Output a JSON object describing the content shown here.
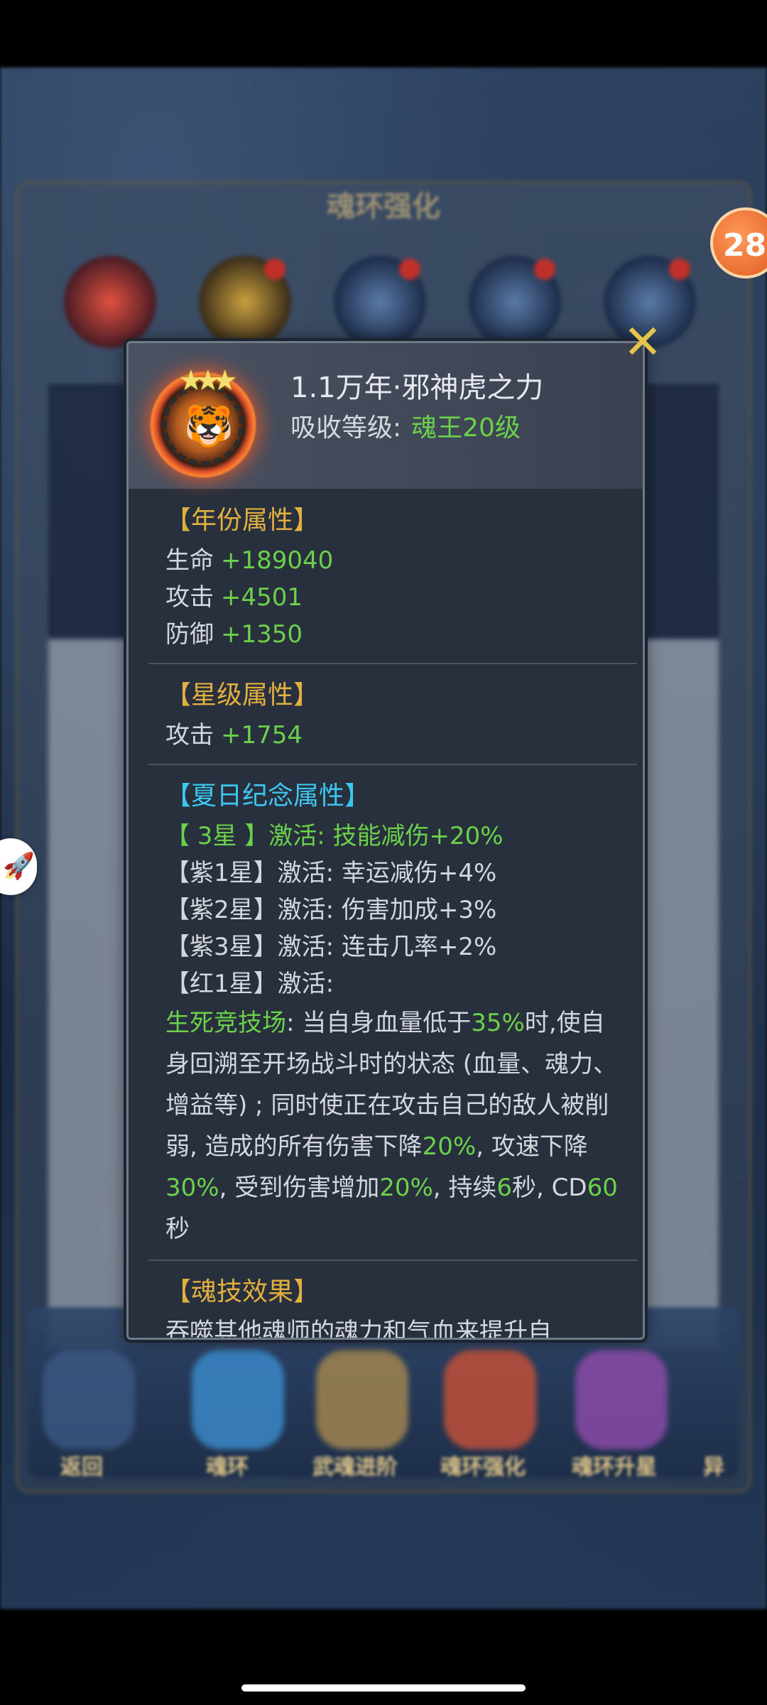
{
  "background": {
    "title": "魂环强化",
    "bottom_nav": [
      "返回",
      "魂环",
      "武魂进阶",
      "魂环强化",
      "魂环升星",
      "异"
    ],
    "side_badge": "28"
  },
  "popup": {
    "ring_title": "1.1万年·邪神虎之力",
    "absorb_label": "吸收等级:",
    "absorb_value": "魂王20级",
    "year_section": {
      "heading": "【年份属性】",
      "stats": [
        {
          "label": "生命",
          "value": "+189040"
        },
        {
          "label": "攻击",
          "value": "+4501"
        },
        {
          "label": "防御",
          "value": "+1350"
        }
      ]
    },
    "star_section": {
      "heading": "【星级属性】",
      "stats": [
        {
          "label": "攻击",
          "value": "+1754"
        }
      ]
    },
    "summer_section": {
      "heading": "【夏日纪念属性】",
      "lines": [
        "【 3星 】激活: 技能减伤+20%",
        "【紫1星】激活: 幸运减伤+4%",
        "【紫2星】激活: 伤害加成+3%",
        "【紫3星】激活: 连击几率+2%",
        "【红1星】激活:"
      ],
      "skill_name": "生死竞技场",
      "desc_a": ": 当自身血量低于",
      "desc_pct1": "35%",
      "desc_b": "时,使自身回溯至开场战斗时的状态 (血量、魂力、增益等) ; 同时使正在攻击自己的敌人被削弱, 造成的所有伤害下降",
      "desc_pct2": "20%",
      "desc_c": ", 攻速下降",
      "desc_pct3": "30%",
      "desc_d": ", 受到伤害增加",
      "desc_pct4": "20%",
      "desc_e": ", 持续",
      "desc_sec": "6",
      "desc_f": "秒, CD",
      "desc_cd": "60",
      "desc_g": "秒"
    },
    "skill_section": {
      "heading": "【魂技效果】",
      "text": "吞噬其他魂师的魂力和气血来提升自"
    }
  }
}
